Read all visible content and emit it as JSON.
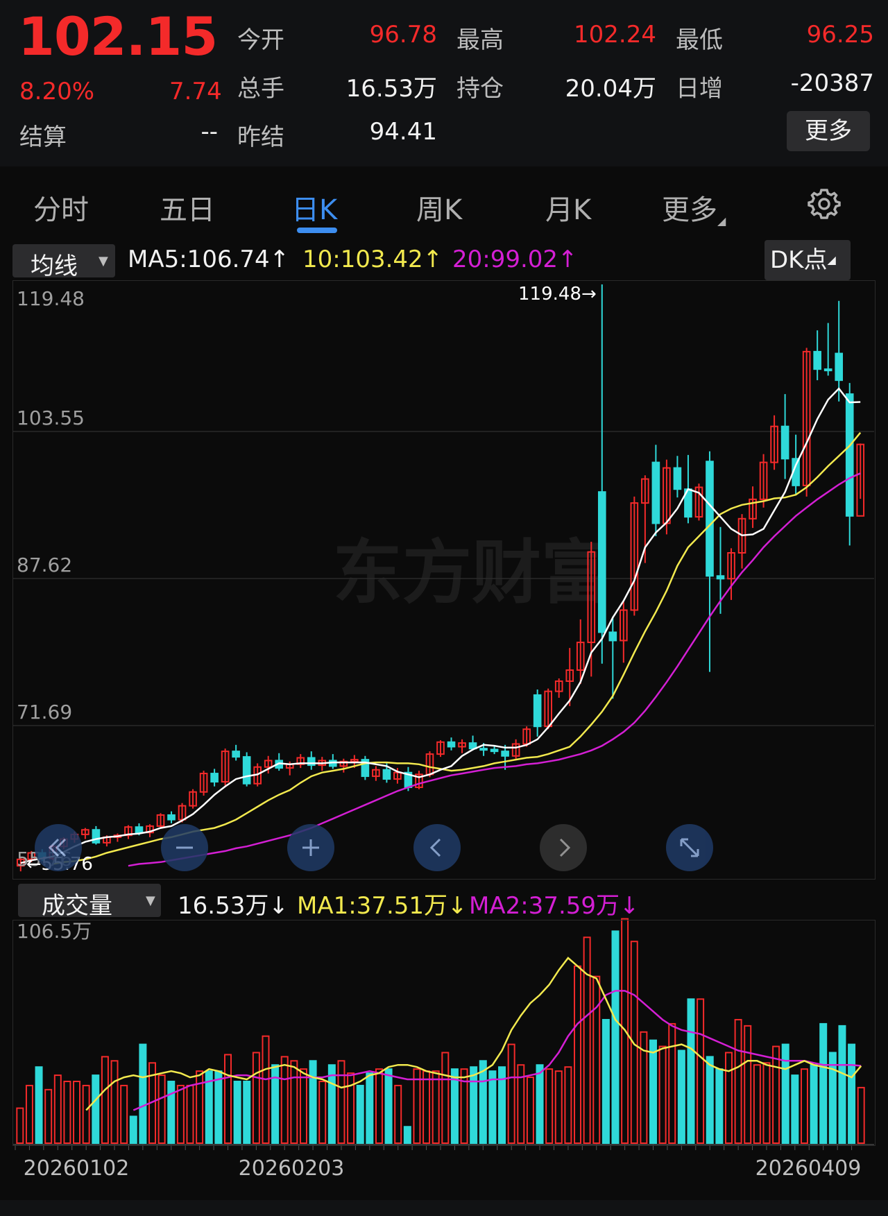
{
  "quote": {
    "price": "102.15",
    "change_pct": "8.20%",
    "change_abs": "7.74",
    "open_label": "今开",
    "open": "96.78",
    "high_label": "最高",
    "high": "102.24",
    "low_label": "最低",
    "low": "96.25",
    "volume_label": "总手",
    "volume": "16.53万",
    "oi_label": "持仓",
    "oi": "20.04万",
    "daily_inc_label": "日增",
    "daily_inc": "-20387",
    "settle_label": "结算",
    "settle": "--",
    "prev_settle_label": "昨结",
    "prev_settle": "94.41",
    "more_label": "更多"
  },
  "tabs": [
    {
      "label": "分时"
    },
    {
      "label": "五日"
    },
    {
      "label": "日K",
      "active": true
    },
    {
      "label": "周K"
    },
    {
      "label": "月K"
    },
    {
      "label": "更多"
    }
  ],
  "ma_bar": {
    "selector": "均线",
    "ma5": "MA5:106.74↑",
    "ma10": "10:103.42↑",
    "ma20": "20:99.02↑",
    "dk_label": "DK点"
  },
  "vol_bar": {
    "selector": "成交量",
    "vol": "16.53万↓",
    "ma1": "MA1:37.51万↓",
    "ma2": "MA2:37.59万↓"
  },
  "colors": {
    "up": "#f42a2a",
    "down": "#2fd9d9",
    "ma5": "#ffffff",
    "ma10": "#f2e94e",
    "ma20": "#d41fd4",
    "accent": "#3d8ef0"
  },
  "chart_data": [
    {
      "type": "candlestick",
      "y_ticks": [
        "119.48",
        "103.55",
        "87.62",
        "71.69",
        "55.76"
      ],
      "ylim": [
        55.76,
        119.48
      ],
      "max_annotation": "119.48→",
      "min_annotation": "←55.76",
      "watermark": "东方财富",
      "x_labels": [
        "20260102",
        "20260203",
        "20260409"
      ],
      "candles": [
        [
          56.5,
          57.5,
          55.9,
          57.2
        ],
        [
          57.2,
          58.1,
          56.9,
          57.9
        ],
        [
          57.9,
          58.3,
          57.0,
          57.3
        ],
        [
          57.3,
          58.8,
          57.1,
          58.6
        ],
        [
          58.6,
          59.6,
          58.3,
          59.4
        ],
        [
          59.4,
          60.2,
          59.0,
          59.9
        ],
        [
          59.9,
          60.6,
          59.4,
          60.4
        ],
        [
          60.4,
          60.8,
          58.8,
          59.0
        ],
        [
          59.0,
          59.8,
          58.6,
          59.6
        ],
        [
          59.6,
          60.0,
          59.1,
          59.8
        ],
        [
          59.8,
          60.9,
          59.4,
          60.7
        ],
        [
          60.7,
          61.1,
          59.8,
          60.1
        ],
        [
          60.1,
          61.0,
          59.6,
          60.8
        ],
        [
          60.8,
          62.2,
          60.5,
          62.0
        ],
        [
          62.0,
          62.4,
          61.1,
          61.5
        ],
        [
          61.5,
          63.3,
          61.2,
          63.0
        ],
        [
          63.0,
          64.8,
          62.7,
          64.5
        ],
        [
          64.5,
          66.8,
          64.1,
          66.5
        ],
        [
          66.5,
          67.0,
          65.1,
          65.6
        ],
        [
          65.6,
          69.2,
          65.2,
          68.9
        ],
        [
          68.9,
          69.6,
          67.9,
          68.3
        ],
        [
          68.3,
          68.8,
          65.1,
          65.4
        ],
        [
          65.4,
          67.6,
          65.1,
          67.2
        ],
        [
          67.2,
          68.4,
          66.5,
          67.9
        ],
        [
          67.9,
          68.7,
          66.8,
          67.1
        ],
        [
          67.1,
          67.8,
          66.3,
          67.5
        ],
        [
          67.5,
          68.6,
          67.1,
          68.2
        ],
        [
          68.2,
          68.9,
          66.9,
          67.4
        ],
        [
          67.4,
          68.3,
          66.8,
          67.9
        ],
        [
          67.9,
          68.6,
          67.0,
          67.3
        ],
        [
          67.3,
          68.1,
          66.6,
          67.8
        ],
        [
          67.8,
          68.5,
          67.1,
          68.0
        ],
        [
          68.0,
          68.4,
          65.8,
          66.2
        ],
        [
          66.2,
          67.3,
          65.7,
          66.9
        ],
        [
          66.9,
          67.6,
          65.5,
          65.9
        ],
        [
          65.9,
          67.1,
          65.4,
          66.6
        ],
        [
          66.6,
          67.2,
          64.6,
          65.0
        ],
        [
          65.0,
          66.8,
          64.8,
          66.4
        ],
        [
          66.4,
          68.9,
          66.1,
          68.6
        ],
        [
          68.6,
          70.1,
          68.3,
          69.9
        ],
        [
          69.9,
          70.4,
          69.0,
          69.4
        ],
        [
          69.4,
          70.2,
          68.7,
          69.8
        ],
        [
          69.8,
          70.6,
          69.0,
          69.2
        ],
        [
          69.2,
          69.8,
          68.4,
          69.1
        ],
        [
          69.1,
          69.5,
          68.6,
          68.9
        ],
        [
          68.9,
          69.6,
          66.9,
          68.4
        ],
        [
          68.4,
          70.2,
          68.1,
          69.7
        ],
        [
          69.7,
          71.6,
          69.4,
          71.3
        ],
        [
          75.0,
          75.6,
          70.5,
          71.6
        ],
        [
          71.6,
          75.7,
          71.3,
          75.4
        ],
        [
          75.4,
          76.8,
          74.7,
          76.5
        ],
        [
          76.5,
          80.1,
          73.8,
          77.7
        ],
        [
          77.7,
          83.2,
          76.2,
          80.7
        ],
        [
          80.7,
          91.6,
          77.0,
          90.5
        ],
        [
          97.0,
          119.48,
          78.4,
          81.8
        ],
        [
          81.8,
          83.5,
          74.6,
          80.9
        ],
        [
          80.9,
          85.1,
          78.5,
          84.2
        ],
        [
          84.2,
          96.5,
          83.6,
          95.8
        ],
        [
          95.8,
          98.8,
          89.3,
          98.4
        ],
        [
          100.2,
          102.1,
          92.2,
          93.6
        ],
        [
          93.6,
          100.5,
          92.4,
          99.6
        ],
        [
          99.6,
          100.9,
          96.4,
          97.3
        ],
        [
          97.3,
          101.0,
          93.6,
          94.3
        ],
        [
          94.3,
          97.9,
          93.9,
          97.5
        ],
        [
          100.3,
          101.4,
          77.5,
          87.9
        ],
        [
          87.9,
          93.2,
          83.8,
          87.6
        ],
        [
          87.6,
          90.9,
          85.3,
          90.4
        ],
        [
          90.4,
          94.6,
          88.7,
          94.1
        ],
        [
          94.1,
          97.6,
          93.1,
          96.2
        ],
        [
          96.2,
          101.1,
          95.3,
          100.2
        ],
        [
          100.2,
          105.3,
          99.4,
          104.1
        ],
        [
          104.1,
          107.6,
          98.4,
          100.6
        ],
        [
          100.6,
          103.2,
          96.7,
          97.7
        ],
        [
          97.7,
          112.6,
          96.5,
          112.2
        ],
        [
          112.2,
          114.5,
          109.1,
          110.3
        ],
        [
          110.3,
          115.3,
          109.6,
          110.2
        ],
        [
          112.0,
          117.7,
          106.8,
          109.1
        ],
        [
          107.6,
          108.8,
          91.2,
          94.4
        ],
        [
          94.4,
          102.24,
          96.25,
          102.15
        ]
      ],
      "ma5": [
        56.8,
        57.1,
        57.3,
        57.5,
        58.0,
        58.6,
        59.1,
        59.4,
        59.6,
        59.7,
        59.9,
        60.0,
        60.2,
        60.6,
        60.8,
        61.4,
        62.1,
        63.1,
        64.2,
        65.1,
        65.9,
        66.2,
        66.4,
        67.0,
        67.6,
        67.5,
        67.6,
        67.6,
        67.6,
        67.7,
        67.7,
        67.7,
        67.7,
        67.5,
        67.3,
        66.7,
        66.4,
        66.1,
        66.4,
        66.9,
        67.3,
        68.4,
        69.1,
        69.6,
        69.5,
        69.3,
        69.3,
        69.6,
        70.2,
        71.5,
        73.0,
        74.4,
        76.4,
        79.6,
        81.1,
        83.4,
        85.2,
        87.4,
        91.0,
        92.6,
        93.7,
        95.2,
        97.3,
        96.9,
        95.6,
        94.3,
        93.0,
        92.3,
        92.4,
        93.0,
        95.0,
        97.0,
        99.9,
        102.3,
        104.9,
        107.0,
        108.2,
        106.7,
        106.74
      ],
      "ma10": [
        56.7,
        56.9,
        57.0,
        57.2,
        57.5,
        57.9,
        58.2,
        58.5,
        58.8,
        59.1,
        59.4,
        59.6,
        59.9,
        60.2,
        60.4,
        60.6,
        61.0,
        61.5,
        62.2,
        62.9,
        63.6,
        64.2,
        64.7,
        65.5,
        66.2,
        66.6,
        66.8,
        67.0,
        67.3,
        67.6,
        67.7,
        67.7,
        67.6,
        67.6,
        67.5,
        67.2,
        67.0,
        66.8,
        66.9,
        67.1,
        67.3,
        67.6,
        67.8,
        68.0,
        68.2,
        68.3,
        68.6,
        69.0,
        69.4,
        70.5,
        71.8,
        73.2,
        74.9,
        77.2,
        79.6,
        81.9,
        84.0,
        86.3,
        89.0,
        91.0,
        92.2,
        93.4,
        94.6,
        95.2,
        95.6,
        95.8,
        96.0,
        96.3,
        96.4,
        96.7,
        97.5,
        98.6,
        99.8,
        100.9,
        102.0,
        103.42
      ],
      "ma20": [
        56.5,
        56.7,
        56.8,
        56.9,
        57.1,
        57.3,
        57.5,
        57.7,
        57.9,
        58.1,
        58.4,
        58.6,
        58.9,
        59.2,
        59.5,
        59.8,
        60.2,
        60.6,
        61.1,
        61.6,
        62.1,
        62.6,
        63.1,
        63.6,
        64.1,
        64.6,
        65.0,
        65.4,
        65.7,
        66.0,
        66.3,
        66.5,
        66.7,
        66.9,
        67.1,
        67.2,
        67.3,
        67.5,
        67.6,
        67.8,
        68.0,
        68.3,
        68.6,
        69.0,
        69.5,
        70.2,
        71.0,
        72.0,
        73.3,
        74.8,
        76.4,
        78.1,
        79.9,
        81.7,
        83.5,
        85.2,
        86.8,
        88.3,
        89.6,
        91.0,
        92.2,
        93.3,
        94.4,
        95.3,
        96.2,
        97.0,
        97.8,
        98.5,
        99.02
      ]
    },
    {
      "type": "bar",
      "title": "成交量",
      "ylabel_max": "106.5万",
      "ylim": [
        0,
        106.5
      ],
      "volumes": [
        17,
        28,
        37,
        26,
        33,
        30,
        30,
        28,
        33,
        42,
        40,
        28,
        13,
        48,
        39,
        33,
        30,
        28,
        28,
        35,
        35,
        35,
        43,
        30,
        30,
        44,
        52,
        38,
        42,
        40,
        36,
        40,
        30,
        38,
        40,
        34,
        28,
        34,
        36,
        36,
        28,
        8,
        36,
        35,
        35,
        44,
        36,
        36,
        37,
        40,
        35,
        37,
        48,
        38,
        32,
        38,
        36,
        35,
        37,
        86,
        100,
        81,
        60,
        103,
        109,
        98,
        54,
        50,
        47,
        58,
        45,
        70,
        70,
        42,
        36,
        44,
        60,
        57,
        38,
        39,
        47,
        48,
        33,
        36,
        38,
        58,
        44,
        57,
        48,
        27
      ],
      "ma1": [
        16,
        21,
        26,
        30,
        32,
        33,
        32,
        33,
        34,
        35,
        34,
        32,
        33,
        36,
        35,
        33,
        32,
        31,
        34,
        36,
        37,
        38,
        37,
        34,
        32,
        31,
        29,
        27,
        28,
        30,
        33,
        34,
        37,
        38,
        38,
        37,
        35,
        34,
        33,
        32,
        32,
        33,
        35,
        38,
        45,
        55,
        62,
        68,
        72,
        77,
        84,
        90,
        86,
        82,
        80,
        70,
        60,
        55,
        48,
        45,
        44,
        46,
        47,
        48,
        46,
        42,
        38,
        36,
        35,
        37,
        40,
        40,
        38,
        37,
        36,
        38,
        40,
        38,
        37,
        36,
        34,
        32,
        37.51
      ],
      "ma2": [
        16,
        18,
        20,
        22,
        24,
        26,
        28,
        29,
        30,
        31,
        32,
        33,
        33,
        32,
        31,
        32,
        31,
        32,
        32,
        32,
        32,
        33,
        33,
        33,
        34,
        35,
        34,
        33,
        32,
        31,
        31,
        31,
        31,
        31,
        31,
        30,
        30,
        30,
        31,
        31,
        32,
        32,
        33,
        34,
        38,
        44,
        52,
        58,
        62,
        66,
        72,
        74,
        74,
        72,
        68,
        64,
        60,
        57,
        55,
        54,
        53,
        51,
        49,
        47,
        45,
        44,
        43,
        42,
        41,
        40,
        40,
        40,
        39,
        38,
        38,
        38,
        38,
        37.59
      ]
    }
  ]
}
